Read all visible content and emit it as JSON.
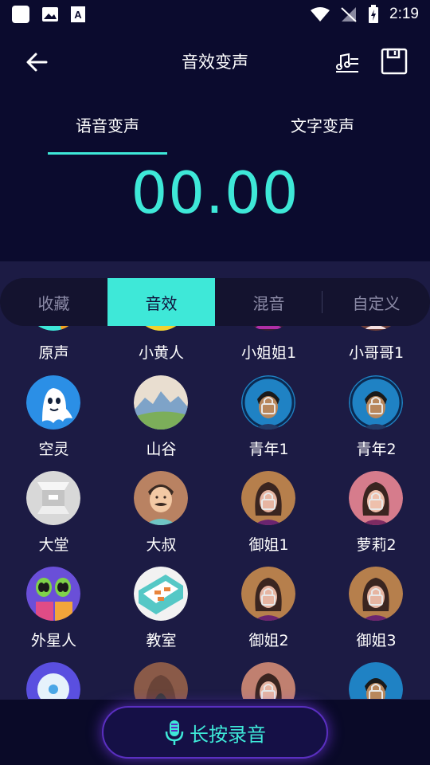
{
  "status": {
    "time": "2:19"
  },
  "header": {
    "title": "音效变声"
  },
  "tabs": [
    {
      "label": "语音变声"
    },
    {
      "label": "文字变声"
    }
  ],
  "timer": "00.00",
  "segments": [
    {
      "label": "收藏"
    },
    {
      "label": "音效"
    },
    {
      "label": "混音"
    },
    {
      "label": "自定义"
    }
  ],
  "effects": {
    "row0": [
      "原声",
      "小黄人",
      "小姐姐1",
      "小哥哥1"
    ],
    "row1": [
      "空灵",
      "山谷",
      "青年1",
      "青年2"
    ],
    "row2": [
      "大堂",
      "大叔",
      "御姐1",
      "萝莉2"
    ],
    "row3": [
      "外星人",
      "教室",
      "御姐2",
      "御姐3"
    ]
  },
  "record": {
    "label": "长按录音"
  },
  "colors": {
    "accent": "#3ee8d8",
    "background": "#0b0b2e",
    "panel": "#1c1b44"
  }
}
